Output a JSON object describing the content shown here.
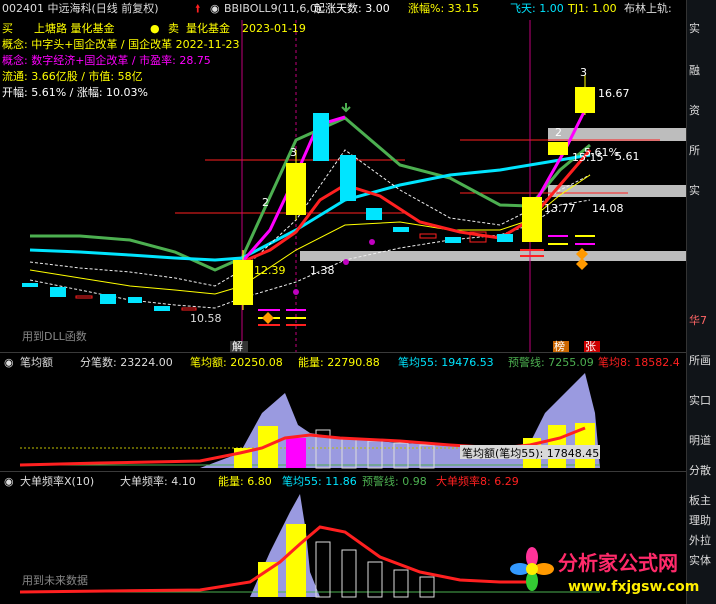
{
  "header": {
    "stock": "002401 中远海科(日线 前复权)",
    "indicator": "BBIBOLL9(11,6,0)",
    "qizhang_label": "起涨天数: 3.00",
    "zhangfu_label": "涨幅%: 33.15",
    "feitian_label": "飞天: 1.00",
    "tj1_label": "TJ1: 1.00",
    "bulin_label": "布林上轨:"
  },
  "info": {
    "line1_buy": "买",
    "line1_sugar": "上塘路 量化基金",
    "line1_sell": "卖",
    "line1_fund": "量化基金",
    "line1_date": "2023-01-19",
    "line2": "概念: 中字头+国企改革 / 国企改革 2022-11-23",
    "line3": "概念: 数字经济+国企改革 / 市盈率: 28.75",
    "line4": "流通: 3.66亿股 / 市值: 58亿",
    "line5": "开幅: 5.61% / 涨幅: 10.03%"
  },
  "main_annotations": {
    "price_high": "16.67",
    "price_a": "15.15",
    "price_b": "5.61",
    "price_c": "13.77",
    "price_d": "14.08",
    "price_low": "10.58",
    "price_mid": "12.39",
    "price_mid2": "1.38",
    "pct_label": "5.61%",
    "num1": "1",
    "num2": "2",
    "num3": "3",
    "num2b": "2",
    "num3b": "3",
    "tag_jie": "解",
    "tag_bang": "榜",
    "tag_zhang": "张",
    "dll": "用到DLL函数",
    "watermark": "www.fxjgsw.com"
  },
  "panel2": {
    "title": "笔均额",
    "fenbi": "分笔数: 23224.00",
    "bijun": "笔均额: 20250.08",
    "nengliang": "能量: 22790.88",
    "bijun55": "笔均55: 19476.53",
    "yujing": "预警线: 7255.09",
    "bijun8": "笔均8: 18582.4",
    "tooltip": "笔均额(笔均55): 17848.45"
  },
  "panel3": {
    "title": "大单频率X(10)",
    "pinlv": "大单频率: 4.10",
    "nengliang": "能量: 6.80",
    "bijun55": "笔均55: 11.86",
    "yujing": "预警线: 0.98",
    "dadan8": "大单频率8: 6.29",
    "footer": "用到未来数据"
  },
  "right_strip": [
    "实",
    "融",
    "资",
    "所",
    "实",
    "华7",
    "所画",
    "实口",
    "明道",
    "分散",
    "板主",
    "理助",
    "外拉",
    "实体"
  ],
  "logo": {
    "title": "分析家公式网",
    "url": "www.fxjgsw.com"
  },
  "colors": {
    "bg": "#000000",
    "yellow": "#ffff00",
    "cyan": "#00e5ff",
    "magenta": "#ff00ff",
    "red": "#ff2020",
    "green": "#4caf50",
    "lavender": "#9a9ae0"
  }
}
